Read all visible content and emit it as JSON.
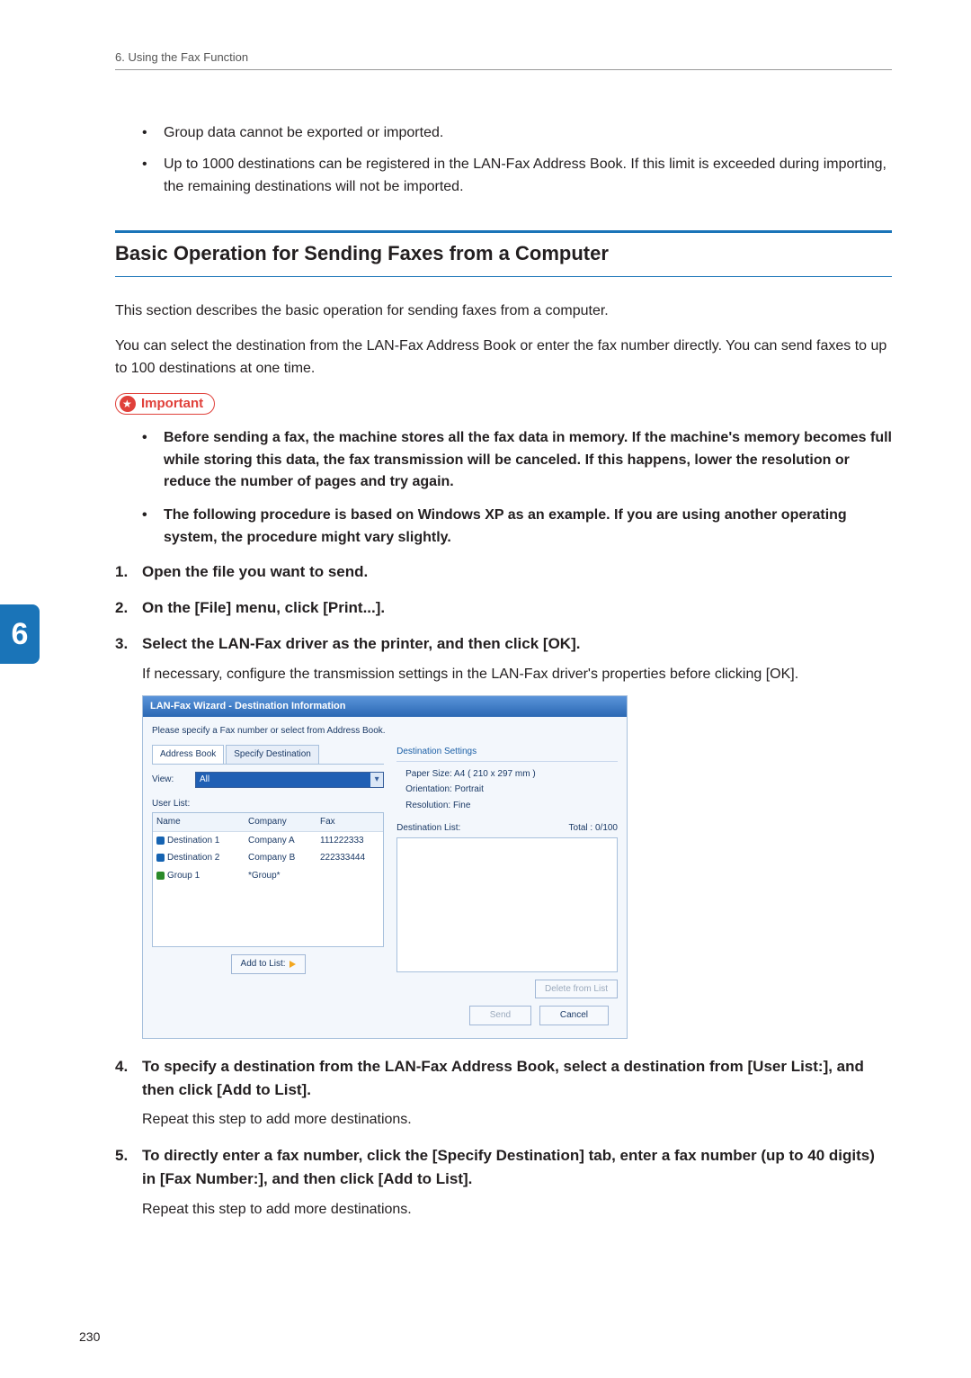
{
  "runningHead": "6. Using the Fax Function",
  "sideTab": "6",
  "pageNumber": "230",
  "bullets_intro": [
    "Group data cannot be exported or imported.",
    "Up to 1000 destinations can be registered in the LAN-Fax Address Book. If this limit is exceeded during importing, the remaining destinations will not be imported."
  ],
  "sectionHeading": "Basic Operation for Sending Faxes from a Computer",
  "para1": "This section describes the basic operation for sending faxes from a computer.",
  "para2": "You can select the destination from the LAN-Fax Address Book or enter the fax number directly. You can send faxes to up to 100 destinations at one time.",
  "importantLabel": "Important",
  "importantBullets": [
    "Before sending a fax, the machine stores all the fax data in memory. If the machine's memory becomes full while storing this data, the fax transmission will be canceled. If this happens, lower the resolution or reduce the number of pages and try again.",
    "The following procedure is based on Windows XP as an example. If you are using another operating system, the procedure might vary slightly."
  ],
  "steps": {
    "s1": "Open the file you want to send.",
    "s2": "On the [File] menu, click [Print...].",
    "s3": "Select the LAN-Fax driver as the printer, and then click [OK].",
    "s3b": "If necessary, configure the transmission settings in the LAN-Fax driver's properties before clicking [OK].",
    "s4": "To specify a destination from the LAN-Fax Address Book, select a destination from [User List:], and then click [Add to List].",
    "s4b": "Repeat this step to add more destinations.",
    "s5": "To directly enter a fax number, click the [Specify Destination] tab, enter a fax number (up to 40 digits) in [Fax Number:], and then click [Add to List].",
    "s5b": "Repeat this step to add more destinations."
  },
  "dialog": {
    "title": "LAN-Fax Wizard - Destination Information",
    "subtitle": "Please specify a Fax number or select from Address Book.",
    "tab1": "Address Book",
    "tab2": "Specify Destination",
    "viewLabel": "View:",
    "viewValue": "All",
    "userListLabel": "User List:",
    "cols": {
      "name": "Name",
      "company": "Company",
      "fax": "Fax"
    },
    "rows": [
      {
        "name": "Destination 1",
        "company": "Company A",
        "fax": "111222333",
        "type": "person"
      },
      {
        "name": "Destination 2",
        "company": "Company B",
        "fax": "222333444",
        "type": "person"
      },
      {
        "name": "Group 1",
        "company": "*Group*",
        "fax": "",
        "type": "group"
      }
    ],
    "addToList": "Add to List:",
    "destSettingsHead": "Destination Settings",
    "paperSize": "Paper Size: A4 ( 210 x 297 mm )",
    "orientation": "Orientation: Portrait",
    "resolution": "Resolution: Fine",
    "destListLabel": "Destination List:",
    "totalLabel": "Total :  0/100",
    "deleteFromList": "Delete from List",
    "sendBtn": "Send",
    "cancelBtn": "Cancel"
  }
}
